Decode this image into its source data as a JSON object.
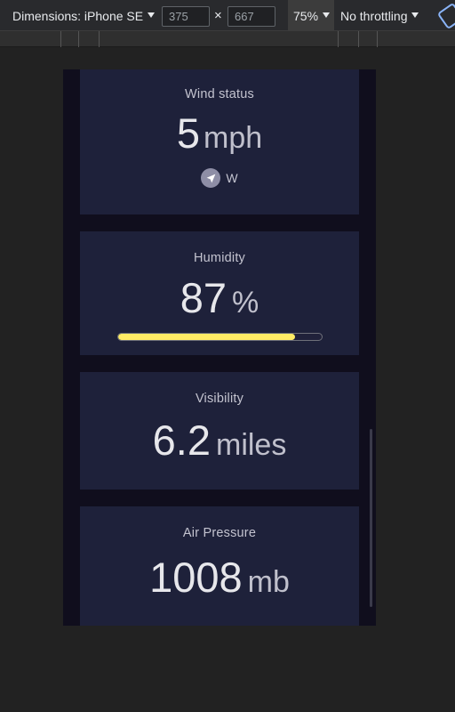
{
  "devtools": {
    "dimensions_label": "Dimensions: iPhone SE",
    "width_value": "375",
    "height_value": "667",
    "times": "×",
    "zoom": "75%",
    "throttling": "No throttling",
    "icons": [
      "caret-down-icon",
      "rotate-icon"
    ]
  },
  "cards": {
    "wind": {
      "title": "Wind status",
      "value": "5",
      "unit": "mph",
      "direction": "W",
      "icon": "navigation-arrow-icon"
    },
    "humidity": {
      "title": "Humidity",
      "value": "87",
      "unit": "%",
      "percent": 87,
      "bar_color": "#ffec65"
    },
    "visibility": {
      "title": "Visibility",
      "value": "6.2",
      "unit": "miles"
    },
    "pressure": {
      "title": "Air Pressure",
      "value": "1008",
      "unit": "mb"
    }
  },
  "colors": {
    "card_bg": "#1e213a",
    "page_bg": "#100e1d",
    "devtools_bg": "#292a2d"
  }
}
